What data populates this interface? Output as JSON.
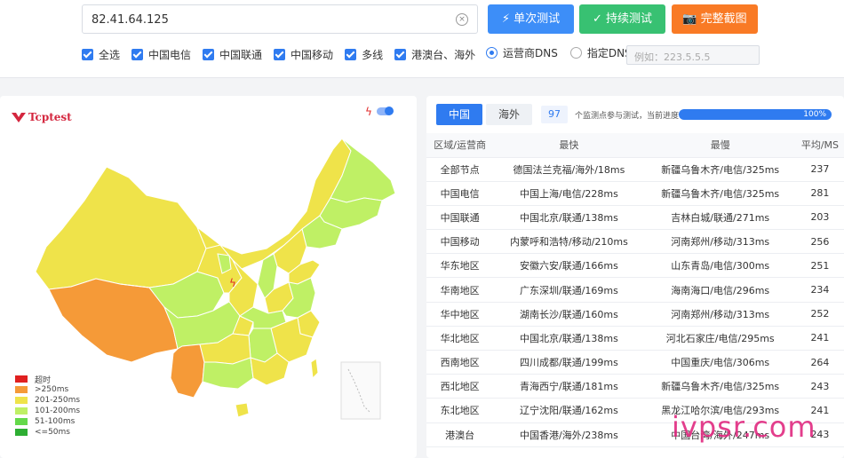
{
  "search": {
    "value": "82.41.64.125",
    "clear": "×"
  },
  "buttons": {
    "single": "⚡ 单次测试",
    "continuous": "✓ 持续测试",
    "screenshot": "📷 完整截图"
  },
  "filters": [
    "全选",
    "中国电信",
    "中国联通",
    "中国移动",
    "多线",
    "港澳台、海外"
  ],
  "dns": {
    "carrier": "运营商DNS",
    "custom": "指定DNS:",
    "placeholder": "例如：223.5.5.5"
  },
  "logo": "Tcptest",
  "map": {
    "legend": [
      {
        "label": "超时",
        "color": "#e02020"
      },
      {
        "label": ">250ms",
        "color": "#f59a38"
      },
      {
        "label": "201-250ms",
        "color": "#efe34a"
      },
      {
        "label": "101-200ms",
        "color": "#bff065"
      },
      {
        "label": "51-100ms",
        "color": "#64d94a"
      },
      {
        "label": "<=50ms",
        "color": "#2eae33"
      }
    ]
  },
  "results": {
    "tabs": [
      "中国",
      "海外"
    ],
    "count": "97",
    "desc": "个监测点参与测试，当前进度：",
    "progress": "100%",
    "progress_value": 100,
    "headers": [
      "区域/运营商",
      "最快",
      "最慢",
      "平均/MS"
    ],
    "rows": [
      [
        "全部节点",
        "德国法兰克福/海外/18ms",
        "新疆乌鲁木齐/电信/325ms",
        "237"
      ],
      [
        "中国电信",
        "中国上海/电信/228ms",
        "新疆乌鲁木齐/电信/325ms",
        "281"
      ],
      [
        "中国联通",
        "中国北京/联通/138ms",
        "吉林白城/联通/271ms",
        "203"
      ],
      [
        "中国移动",
        "内蒙呼和浩特/移动/210ms",
        "河南郑州/移动/313ms",
        "256"
      ],
      [
        "华东地区",
        "安徽六安/联通/166ms",
        "山东青岛/电信/300ms",
        "251"
      ],
      [
        "华南地区",
        "广东深圳/联通/169ms",
        "海南海口/电信/296ms",
        "234"
      ],
      [
        "华中地区",
        "湖南长沙/联通/160ms",
        "河南郑州/移动/313ms",
        "252"
      ],
      [
        "华北地区",
        "中国北京/联通/138ms",
        "河北石家庄/电信/295ms",
        "241"
      ],
      [
        "西南地区",
        "四川成都/联通/199ms",
        "中国重庆/电信/306ms",
        "264"
      ],
      [
        "西北地区",
        "青海西宁/联通/181ms",
        "新疆乌鲁木齐/电信/325ms",
        "243"
      ],
      [
        "东北地区",
        "辽宁沈阳/联通/162ms",
        "黑龙江哈尔滨/电信/293ms",
        "241"
      ],
      [
        "港澳台",
        "中国香港/海外/238ms",
        "中国台湾/海外/247ms",
        "243"
      ]
    ]
  },
  "watermark": "ivpsr.com"
}
